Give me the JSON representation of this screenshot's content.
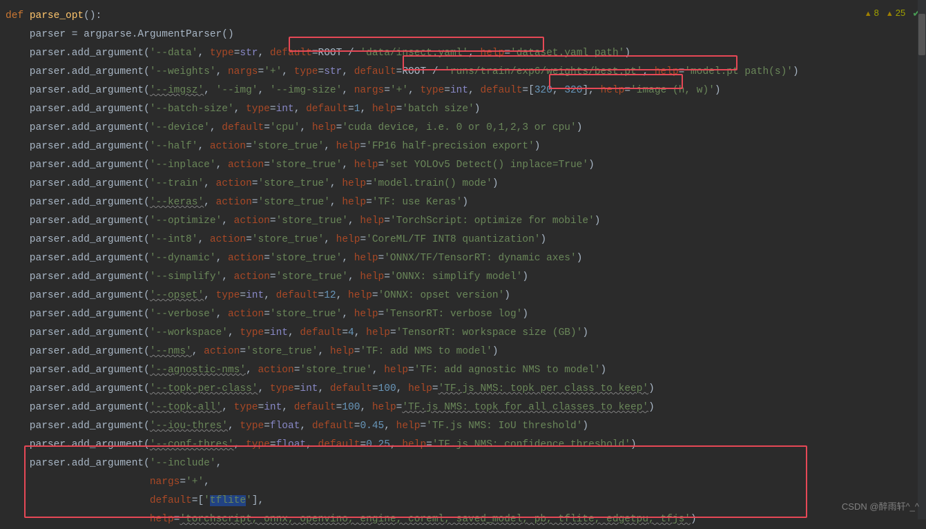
{
  "badges": {
    "warn1": "8",
    "warn2": "25"
  },
  "watermark": "CSDN @醉雨轩^_^",
  "fn_def": "def ",
  "fn_name": "parse_opt",
  "paren": "():",
  "lines": {
    "l2": "    parser = argparse.ArgumentParser()",
    "l3": {
      "a": "    parser.add_argument(",
      "s1": "'--data'",
      "c1": ", ",
      "p1": "type",
      "eq": "=",
      "b1": "str",
      "c2": ", ",
      "p2": "default",
      "v": "=ROOT / ",
      "s2": "'data/insect.yaml'",
      "c3": ", ",
      "p3": "help",
      "e": "=",
      "s3": "'dataset.yaml path'",
      "z": ")"
    },
    "l4": {
      "a": "    parser.add_argument(",
      "s1": "'--weights'",
      "c1": ", ",
      "p1": "nargs",
      "e1": "=",
      "s2": "'+'",
      "c2": ", ",
      "p2": "type",
      "e2": "=",
      "b1": "str",
      "c3": ", ",
      "p3": "default",
      "v": "=ROOT / ",
      "s3": "'runs/train/exp6/weights/best.pt'",
      "c4": ", ",
      "p4": "help",
      "e3": "=",
      "s4": "'model.pt path(s)'",
      "z": ")"
    },
    "l5": {
      "a": "    parser.add_argument(",
      "s1": "'--imgsz'",
      "c1": ", ",
      "s2": "'--img'",
      "c2": ", ",
      "s3": "'--img-size'",
      "c3": ", ",
      "p1": "nargs",
      "e1": "=",
      "s4": "'+'",
      "c4": ", ",
      "p2": "type",
      "e2": "=",
      "b1": "int",
      "c5": ", ",
      "p3": "default",
      "e3": "=[",
      "n1": "320",
      "c6": ", ",
      "n2": "320",
      "c7": "], ",
      "p4": "help",
      "e4": "=",
      "s5": "'image (h, w)'",
      "z": ")"
    },
    "l6": {
      "a": "    parser.add_argument(",
      "s1": "'--batch-size'",
      "c1": ", ",
      "p1": "type",
      "e1": "=",
      "b1": "int",
      "c2": ", ",
      "p2": "default",
      "e2": "=",
      "n1": "1",
      "c3": ", ",
      "p3": "help",
      "e3": "=",
      "s2": "'batch size'",
      "z": ")"
    },
    "l7": {
      "a": "    parser.add_argument(",
      "s1": "'--device'",
      "c1": ", ",
      "p1": "default",
      "e1": "=",
      "s2": "'cpu'",
      "c2": ", ",
      "p2": "help",
      "e2": "=",
      "s3": "'cuda device, i.e. 0 or 0,1,2,3 or cpu'",
      "z": ")"
    },
    "l8": {
      "a": "    parser.add_argument(",
      "s1": "'--half'",
      "c1": ", ",
      "p1": "action",
      "e1": "=",
      "s2": "'store_true'",
      "c2": ", ",
      "p2": "help",
      "e2": "=",
      "s3": "'FP16 half-precision export'",
      "z": ")"
    },
    "l9": {
      "a": "    parser.add_argument(",
      "s1": "'--inplace'",
      "c1": ", ",
      "p1": "action",
      "e1": "=",
      "s2": "'store_true'",
      "c2": ", ",
      "p2": "help",
      "e2": "=",
      "s3": "'set YOLOv5 Detect() inplace=True'",
      "z": ")"
    },
    "l10": {
      "a": "    parser.add_argument(",
      "s1": "'--train'",
      "c1": ", ",
      "p1": "action",
      "e1": "=",
      "s2": "'store_true'",
      "c2": ", ",
      "p2": "help",
      "e2": "=",
      "s3": "'model.train() mode'",
      "z": ")"
    },
    "l11": {
      "a": "    parser.add_argument(",
      "s1": "'--keras'",
      "c1": ", ",
      "p1": "action",
      "e1": "=",
      "s2": "'store_true'",
      "c2": ", ",
      "p2": "help",
      "e2": "=",
      "s3": "'TF: use Keras'",
      "z": ")"
    },
    "l12": {
      "a": "    parser.add_argument(",
      "s1": "'--optimize'",
      "c1": ", ",
      "p1": "action",
      "e1": "=",
      "s2": "'store_true'",
      "c2": ", ",
      "p2": "help",
      "e2": "=",
      "s3": "'TorchScript: optimize for mobile'",
      "z": ")"
    },
    "l13": {
      "a": "    parser.add_argument(",
      "s1": "'--int8'",
      "c1": ", ",
      "p1": "action",
      "e1": "=",
      "s2": "'store_true'",
      "c2": ", ",
      "p2": "help",
      "e2": "=",
      "s3": "'CoreML/TF INT8 quantization'",
      "z": ")"
    },
    "l14": {
      "a": "    parser.add_argument(",
      "s1": "'--dynamic'",
      "c1": ", ",
      "p1": "action",
      "e1": "=",
      "s2": "'store_true'",
      "c2": ", ",
      "p2": "help",
      "e2": "=",
      "s3": "'ONNX/TF/TensorRT: dynamic axes'",
      "z": ")"
    },
    "l15": {
      "a": "    parser.add_argument(",
      "s1": "'--simplify'",
      "c1": ", ",
      "p1": "action",
      "e1": "=",
      "s2": "'store_true'",
      "c2": ", ",
      "p2": "help",
      "e2": "=",
      "s3": "'ONNX: simplify model'",
      "z": ")"
    },
    "l16": {
      "a": "    parser.add_argument(",
      "s1": "'--opset'",
      "c1": ", ",
      "p1": "type",
      "e1": "=",
      "b1": "int",
      "c2": ", ",
      "p2": "default",
      "e2": "=",
      "n1": "12",
      "c3": ", ",
      "p3": "help",
      "e3": "=",
      "s2": "'ONNX: opset version'",
      "z": ")"
    },
    "l17": {
      "a": "    parser.add_argument(",
      "s1": "'--verbose'",
      "c1": ", ",
      "p1": "action",
      "e1": "=",
      "s2": "'store_true'",
      "c2": ", ",
      "p2": "help",
      "e2": "=",
      "s3": "'TensorRT: verbose log'",
      "z": ")"
    },
    "l18": {
      "a": "    parser.add_argument(",
      "s1": "'--workspace'",
      "c1": ", ",
      "p1": "type",
      "e1": "=",
      "b1": "int",
      "c2": ", ",
      "p2": "default",
      "e2": "=",
      "n1": "4",
      "c3": ", ",
      "p3": "help",
      "e3": "=",
      "s2": "'TensorRT: workspace size (GB)'",
      "z": ")"
    },
    "l19": {
      "a": "    parser.add_argument(",
      "s1": "'--nms'",
      "c1": ", ",
      "p1": "action",
      "e1": "=",
      "s2": "'store_true'",
      "c2": ", ",
      "p2": "help",
      "e2": "=",
      "s3": "'TF: add NMS to model'",
      "z": ")"
    },
    "l20": {
      "a": "    parser.add_argument(",
      "s1": "'--agnostic-nms'",
      "c1": ", ",
      "p1": "action",
      "e1": "=",
      "s2": "'store_true'",
      "c2": ", ",
      "p2": "help",
      "e2": "=",
      "s3": "'TF: add agnostic NMS to model'",
      "z": ")"
    },
    "l21": {
      "a": "    parser.add_argument(",
      "s1": "'--topk-per-class'",
      "c1": ", ",
      "p1": "type",
      "e1": "=",
      "b1": "int",
      "c2": ", ",
      "p2": "default",
      "e2": "=",
      "n1": "100",
      "c3": ", ",
      "p3": "help",
      "e3": "=",
      "s2": "'TF.js NMS: topk per class to keep'",
      "z": ")"
    },
    "l22": {
      "a": "    parser.add_argument(",
      "s1": "'--topk-all'",
      "c1": ", ",
      "p1": "type",
      "e1": "=",
      "b1": "int",
      "c2": ", ",
      "p2": "default",
      "e2": "=",
      "n1": "100",
      "c3": ", ",
      "p3": "help",
      "e3": "=",
      "s2": "'TF.js NMS: topk for all classes to keep'",
      "z": ")"
    },
    "l23": {
      "a": "    parser.add_argument(",
      "s1": "'--iou-thres'",
      "c1": ", ",
      "p1": "type",
      "e1": "=",
      "b1": "float",
      "c2": ", ",
      "p2": "default",
      "e2": "=",
      "n1": "0.45",
      "c3": ", ",
      "p3": "help",
      "e3": "=",
      "s2": "'TF.js NMS: IoU threshold'",
      "z": ")"
    },
    "l24": {
      "a": "    parser.add_argument(",
      "s1": "'--conf-thres'",
      "c1": ", ",
      "p1": "type",
      "e1": "=",
      "b1": "float",
      "c2": ", ",
      "p2": "default",
      "e2": "=",
      "n1": "0.25",
      "c3": ", ",
      "p3": "help",
      "e3": "=",
      "s2": "'TF.js NMS: confidence threshold'",
      "z": ")"
    },
    "l25": {
      "a": "    parser.add_argument(",
      "s1": "'--include'",
      "z": ","
    },
    "l26": {
      "ws": "                        ",
      "p": "nargs",
      "e": "=",
      "s": "'+'",
      "z": ","
    },
    "l27": {
      "ws": "                        ",
      "p": "default",
      "e": "=[",
      "s": "'tflite'",
      "z": "],"
    },
    "l28": {
      "ws": "                        ",
      "p": "help",
      "e": "=",
      "s": "'torchscript, onnx, openvino, engine, coreml, saved_model, pb, tflite, edgetpu, tfjs'",
      "z": ")"
    }
  }
}
